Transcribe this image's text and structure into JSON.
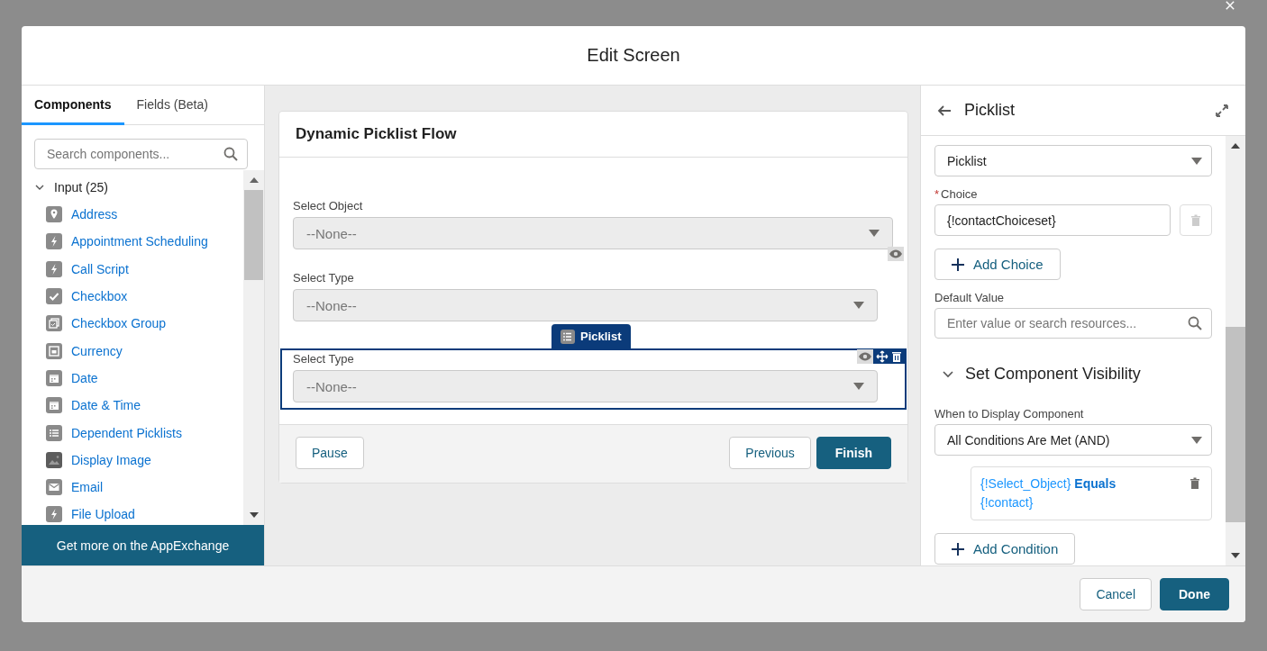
{
  "modal": {
    "title": "Edit Screen"
  },
  "left_panel": {
    "tabs": [
      {
        "label": "Components",
        "selected": true
      },
      {
        "label": "Fields (Beta)",
        "selected": false
      }
    ],
    "search": {
      "placeholder": "Search components..."
    },
    "group": {
      "label": "Input (25)",
      "expanded": true
    },
    "items": [
      {
        "label": "Address",
        "kind": "pin"
      },
      {
        "label": "Appointment Scheduling",
        "kind": "bolt"
      },
      {
        "label": "Call Script",
        "kind": "bolt"
      },
      {
        "label": "Checkbox",
        "kind": "check"
      },
      {
        "label": "Checkbox Group",
        "kind": "checkgroup"
      },
      {
        "label": "Currency",
        "kind": "currency"
      },
      {
        "label": "Date",
        "kind": "calendar"
      },
      {
        "label": "Date & Time",
        "kind": "calendar"
      },
      {
        "label": "Dependent Picklists",
        "kind": "list"
      },
      {
        "label": "Display Image",
        "kind": "image"
      },
      {
        "label": "Email",
        "kind": "mail"
      },
      {
        "label": "File Upload",
        "kind": "bolt"
      }
    ],
    "footer_button": "Get more on the AppExchange"
  },
  "canvas": {
    "title": "Dynamic Picklist Flow",
    "fields": [
      {
        "label": "Select Object",
        "value": "--None--",
        "selected": false,
        "visibility": false
      },
      {
        "label": "Select Type",
        "value": "--None--",
        "selected": false,
        "visibility": true
      },
      {
        "label": "Select Type",
        "value": "--None--",
        "selected": true,
        "visibility": true,
        "tag": "Picklist"
      }
    ],
    "buttons": [
      {
        "label": "Pause",
        "kind": "neutral"
      },
      {
        "label": "Previous",
        "kind": "neutral"
      },
      {
        "label": "Finish",
        "kind": "brand"
      }
    ]
  },
  "right_panel": {
    "title": "Picklist",
    "component_type": {
      "value": "Picklist"
    },
    "choice": {
      "label": "Choice",
      "required_mark": "*",
      "value": "{!contactChoiceset}"
    },
    "add_choice": "Add Choice",
    "default_value": {
      "label": "Default Value",
      "placeholder": "Enter value or search resources..."
    },
    "visibility_section": {
      "title": "Set Component Visibility",
      "expanded": true
    },
    "when_to_display": {
      "label": "When to Display Component",
      "value": "All Conditions Are Met (AND)"
    },
    "condition": "{!Select_Object} **Equals** {!contact}",
    "add_condition": "Add Condition"
  },
  "footer": {
    "buttons": [
      {
        "label": "Cancel",
        "kind": "neutral"
      },
      {
        "label": "Done",
        "kind": "brand"
      }
    ]
  }
}
